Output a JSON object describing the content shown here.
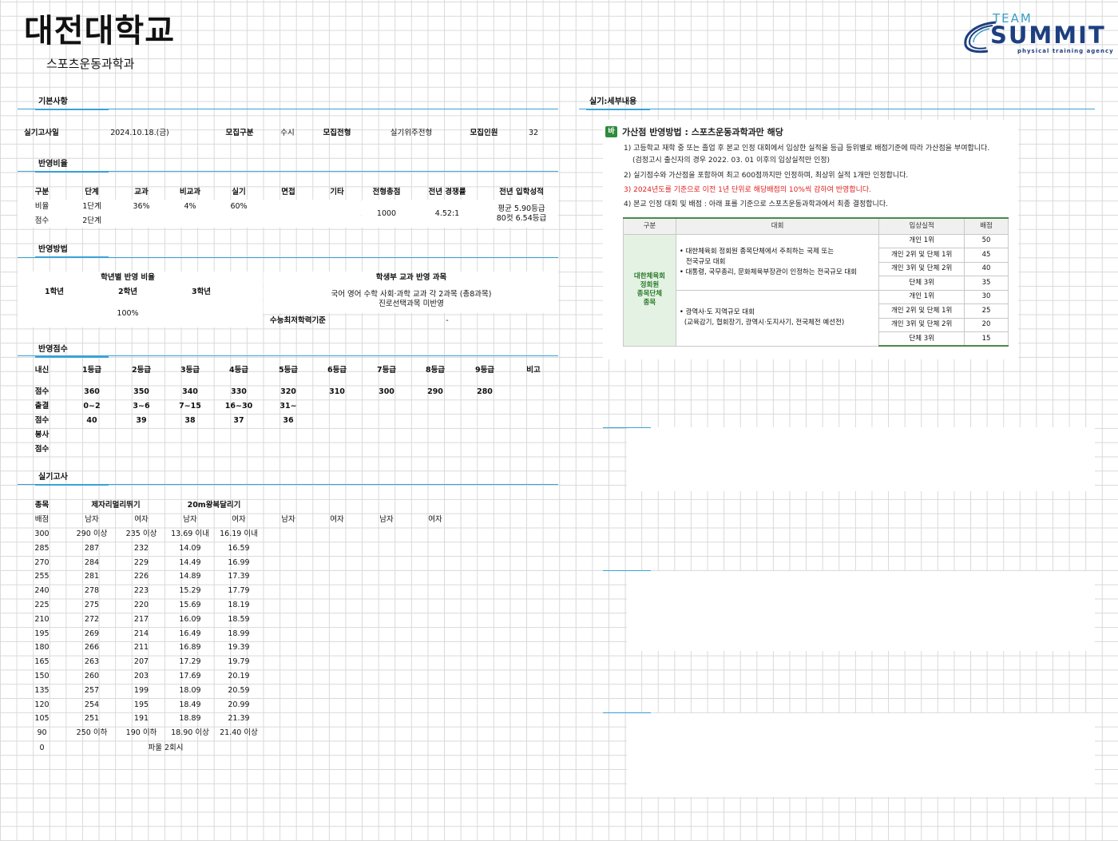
{
  "header": {
    "title": "대전대학교",
    "subtitle": "스포츠운동과학과"
  },
  "logo": {
    "team": "TEAM",
    "summit": "SUMMIT",
    "tagline": "physical training agency"
  },
  "sections": {
    "basic": "기본사항",
    "ratio": "반영비율",
    "method": "반영방법",
    "score": "반영점수",
    "practical": "실기고사",
    "detail": "실기:세부내용"
  },
  "basic": {
    "exam_date_label": "실기고사일",
    "exam_date": "2024.10.18.(금)",
    "recruit_type_label": "모집구분",
    "recruit_type": "수시",
    "recruit_track_label": "모집전형",
    "recruit_track": "실기위주전형",
    "quota_label": "모집인원",
    "quota": "32"
  },
  "ratio": {
    "headers": [
      "구분",
      "단계",
      "교과",
      "비교과",
      "실기",
      "면접",
      "기타",
      "전형총점",
      "전년 경쟁률",
      "전년 입학성적"
    ],
    "row1": [
      "비율",
      "1단계",
      "36%",
      "4%",
      "60%"
    ],
    "row2": [
      "점수",
      "2단계"
    ],
    "total": "1000",
    "competition": "4.52:1",
    "admission_avg": "평균 5.90등급",
    "admission_cut": "80컷 6.54등급"
  },
  "method": {
    "grade_ratio_label": "학년별 반영 비율",
    "grades": [
      "1학년",
      "2학년",
      "3학년"
    ],
    "grade_ratio_value": "100%",
    "subjects_label": "학생부 교과 반영 과목",
    "subjects_line1": "국어 영어 수학 사회·과학 교과 각 2과목 (총8과목)",
    "subjects_line2": "진로선택과목 미반영",
    "csat_label": "수능최저학력기준",
    "csat_value": "-"
  },
  "score": {
    "headers": [
      "내신",
      "1등급",
      "2등급",
      "3등급",
      "4등급",
      "5등급",
      "6등급",
      "7등급",
      "8등급",
      "9등급",
      "비고"
    ],
    "grade_row": [
      "점수",
      "360",
      "350",
      "340",
      "330",
      "320",
      "310",
      "300",
      "290",
      "280"
    ],
    "attend_row": [
      "출결",
      "0~2",
      "3~6",
      "7~15",
      "16~30",
      "31~"
    ],
    "attend_score_row": [
      "점수",
      "40",
      "39",
      "38",
      "37",
      "36"
    ],
    "volunteer_row": [
      "봉사"
    ],
    "volunteer_score_row": [
      "점수"
    ]
  },
  "practical": {
    "event_label": "종목",
    "event1": "제자리멀리뛰기",
    "event2": "20m왕복달리기",
    "sub_headers": [
      "배점",
      "남자",
      "여자",
      "남자",
      "여자",
      "남자",
      "여자",
      "남자",
      "여자"
    ],
    "rows": [
      [
        "300",
        "290 이상",
        "235 이상",
        "13.69 이내",
        "16.19 이내"
      ],
      [
        "285",
        "287",
        "232",
        "14.09",
        "16.59"
      ],
      [
        "270",
        "284",
        "229",
        "14.49",
        "16.99"
      ],
      [
        "255",
        "281",
        "226",
        "14.89",
        "17.39"
      ],
      [
        "240",
        "278",
        "223",
        "15.29",
        "17.79"
      ],
      [
        "225",
        "275",
        "220",
        "15.69",
        "18.19"
      ],
      [
        "210",
        "272",
        "217",
        "16.09",
        "18.59"
      ],
      [
        "195",
        "269",
        "214",
        "16.49",
        "18.99"
      ],
      [
        "180",
        "266",
        "211",
        "16.89",
        "19.39"
      ],
      [
        "165",
        "263",
        "207",
        "17.29",
        "19.79"
      ],
      [
        "150",
        "260",
        "203",
        "17.69",
        "20.19"
      ],
      [
        "135",
        "257",
        "199",
        "18.09",
        "20.59"
      ],
      [
        "120",
        "254",
        "195",
        "18.49",
        "20.99"
      ],
      [
        "105",
        "251",
        "191",
        "18.89",
        "21.39"
      ],
      [
        "90",
        "250 이하",
        "190 이하",
        "18.90 이상",
        "21.40 이상"
      ]
    ],
    "foul_score": "0",
    "foul_text": "파울 2회시"
  },
  "bonus": {
    "badge": "바",
    "heading": "가산점 반영방법 : 스포츠운동과학과만 해당",
    "line1": "1) 고등학교 재학 중 또는 졸업 후 본교 인정 대회에서 입상한 실적을 등급 등위별로 배점기준에 따라 가산점을 부여합니다.",
    "line1b": "(검정고시 출신자의 경우 2022. 03. 01 이후의 입상실적만 인정)",
    "line2": "2) 실기점수와 가산점을 포함하여 최고 600점까지만 인정하며, 최상위 실적 1개만 인정합니다.",
    "line3": "3) 2024년도를 기준으로 이전 1년 단위로 해당배점의 10%씩 감하여 반영합니다.",
    "line4": "4) 본교 인정 대회 및 배점 : 아래 표를 기준으로 스포츠운동과학과에서 최종 결정합니다.",
    "table_headers": [
      "구분",
      "대회",
      "입상실적",
      "배점"
    ],
    "category_line1": "대한체육회",
    "category_line2": "정회원",
    "category_line3": "종목단체",
    "category_line4": "종목",
    "comp1_a": "• 대한체육회 정회원 종목단체에서 주최하는 국제 또는",
    "comp1_b": "전국규모 대회",
    "comp1_c": "• 대통령, 국무총리, 문화체육부장관이 인정하는 전국규모 대회",
    "comp2_a": "• 광역사·도 지역규모 대회",
    "comp2_b": "(교육감기, 협회장기, 광역시·도지사기, 전국체전 예선전)",
    "results": [
      "개인 1위",
      "개인 2위 및 단체 1위",
      "개인 3위 및 단체 2위",
      "단체 3위",
      "개인 1위",
      "개인 2위 및 단체 1위",
      "개인 3위 및 단체 2위",
      "단체 3위"
    ],
    "points": [
      "50",
      "45",
      "40",
      "35",
      "30",
      "25",
      "20",
      "15"
    ]
  }
}
